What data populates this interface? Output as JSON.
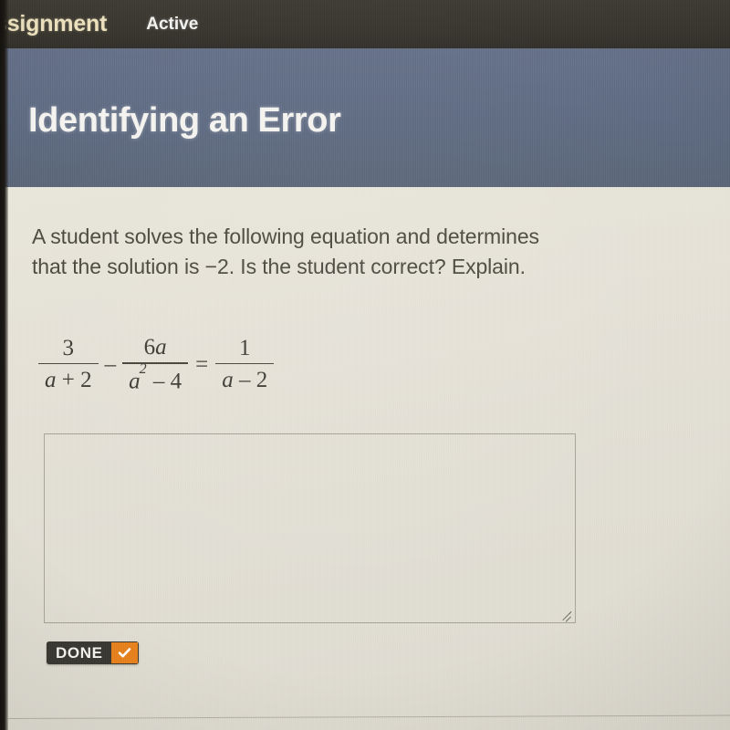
{
  "topbar": {
    "tab_assignment": "ssignment",
    "tab_active": "Active"
  },
  "header": {
    "title": "Identifying an Error"
  },
  "question": {
    "text": "A student solves the following equation and determines that the solution is −2. Is the student correct? Explain."
  },
  "equation": {
    "plain": "3/(a + 2) − 6a/(a² − 4) = 1/(a − 2)",
    "term1": {
      "numerator": "3",
      "denominator_var": "a",
      "denominator_rest": " + 2"
    },
    "operator_minus": "–",
    "term2": {
      "numerator_coeff": "6",
      "numerator_var": "a",
      "denominator_var": "a",
      "denominator_exponent": "2",
      "denominator_rest": " – 4"
    },
    "operator_equals": "=",
    "term3": {
      "numerator": "1",
      "denominator_var": "a",
      "denominator_rest": " – 2"
    }
  },
  "answer": {
    "value": "",
    "placeholder": ""
  },
  "done_button": {
    "label": "DONE",
    "icon": "check-icon"
  },
  "colors": {
    "topbar": "#3b3832",
    "header_band": "#606c83",
    "content_bg": "#e4e1d6",
    "assignment_tab_text": "#efe4c0",
    "done_accent": "#e8821e",
    "done_bg": "#3a3933",
    "text": "#4b4a3f"
  }
}
